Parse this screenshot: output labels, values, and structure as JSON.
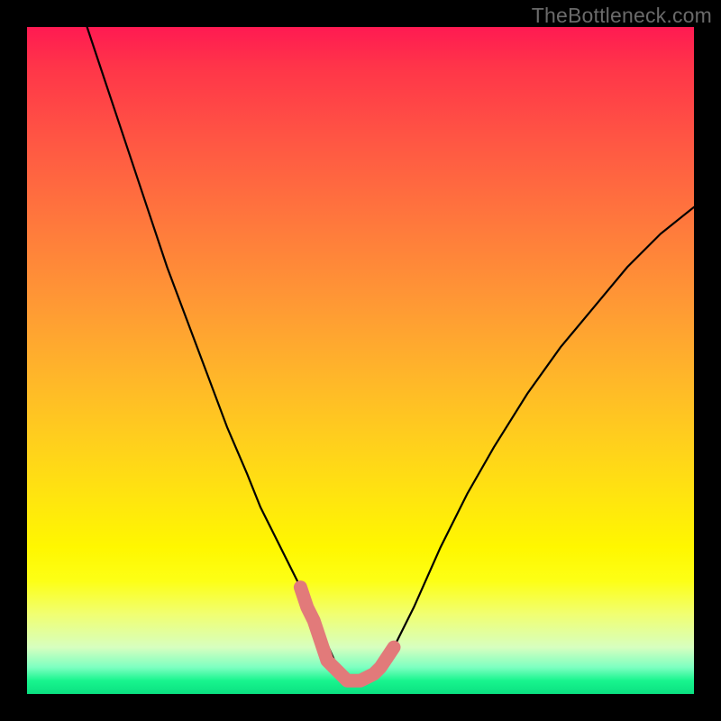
{
  "watermark": "TheBottleneck.com",
  "chart_data": {
    "type": "line",
    "title": "",
    "xlabel": "",
    "ylabel": "",
    "xlim": [
      0,
      100
    ],
    "ylim": [
      0,
      100
    ],
    "series": [
      {
        "name": "curve",
        "style": "thin-black",
        "x": [
          9,
          12,
          15,
          18,
          21,
          24,
          27,
          30,
          33,
          35,
          37,
          39,
          41,
          43,
          47,
          49,
          51,
          53,
          55,
          58,
          62,
          66,
          70,
          75,
          80,
          85,
          90,
          95,
          100
        ],
        "values": [
          100,
          91,
          82,
          73,
          64,
          56,
          48,
          40,
          33,
          28,
          24,
          20,
          16,
          12,
          3,
          2,
          2,
          3,
          7,
          13,
          22,
          30,
          37,
          45,
          52,
          58,
          64,
          69,
          73
        ]
      },
      {
        "name": "highlight",
        "style": "thick-salmon",
        "x": [
          41,
          42,
          43,
          44,
          45,
          46,
          47,
          48,
          49,
          50,
          51,
          52,
          53,
          54,
          55
        ],
        "values": [
          16,
          13,
          11,
          8,
          5,
          4,
          3,
          2,
          2,
          2,
          2.5,
          3,
          4,
          5.5,
          7
        ]
      }
    ],
    "gradient_stops": [
      {
        "pos": 0,
        "color": "#ff1a52"
      },
      {
        "pos": 50,
        "color": "#ffb52a"
      },
      {
        "pos": 78,
        "color": "#fff700"
      },
      {
        "pos": 100,
        "color": "#0be081"
      }
    ]
  }
}
